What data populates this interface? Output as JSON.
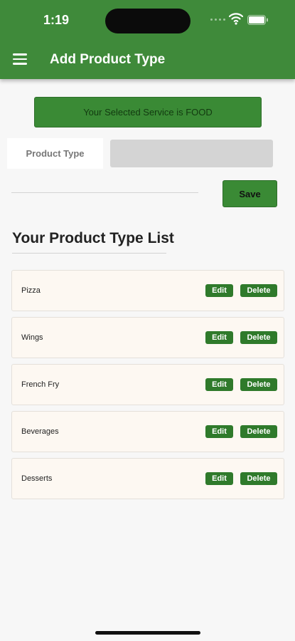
{
  "status_bar": {
    "time": "1:19"
  },
  "appbar": {
    "title": "Add Product Type"
  },
  "service_banner": {
    "text": "Your Selected Service is FOOD"
  },
  "form": {
    "product_type_label": "Product Type",
    "product_type_value": "",
    "save_label": "Save"
  },
  "list": {
    "heading": "Your Product Type List",
    "edit_label": "Edit",
    "delete_label": "Delete",
    "items": [
      {
        "name": "Pizza"
      },
      {
        "name": "Wings"
      },
      {
        "name": "French Fry"
      },
      {
        "name": "Beverages"
      },
      {
        "name": "Desserts"
      }
    ]
  },
  "colors": {
    "primary_green": "#3f8a3a",
    "button_green": "#2f7a2b",
    "row_background": "#fdf8f2",
    "input_background": "#d4d4d4"
  }
}
